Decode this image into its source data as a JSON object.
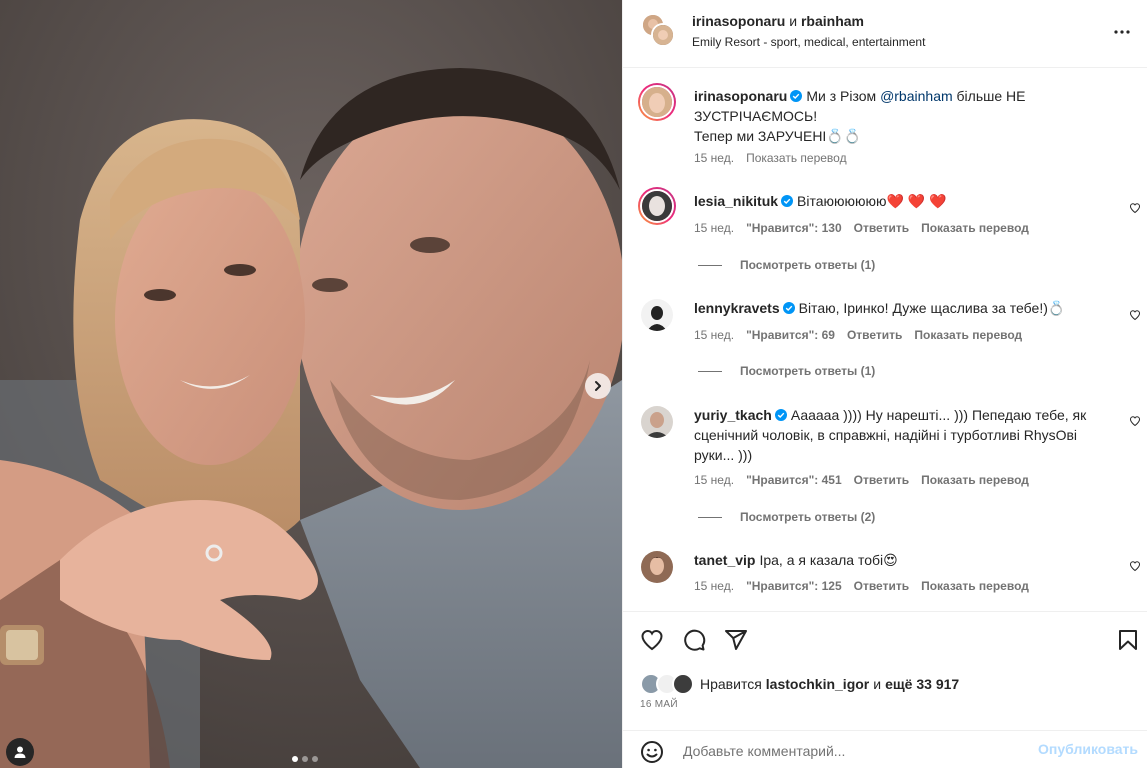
{
  "header": {
    "user1": "irinasoponaru",
    "and": "и",
    "user2": "rbainham",
    "location": "Emily Resort - sport, medical, entertainment"
  },
  "caption": {
    "username": "irinasoponaru",
    "line1_pre": "Ми з Різом ",
    "mention": "@rbainham",
    "line1_post": " більше НЕ ЗУСТРІЧАЄМОСЬ!",
    "line2": "Тепер ми ЗАРУЧЕНІ💍💍",
    "time": "15 нед.",
    "translate": "Показать перевод"
  },
  "comments": [
    {
      "username": "lesia_nikituk",
      "text": "Вітаюююююю❤️ ❤️ ❤️",
      "time": "15 нед.",
      "likes": "\"Нравится\": 130",
      "reply": "Ответить",
      "translate": "Показать перевод",
      "view_replies": "Посмотреть ответы (1)"
    },
    {
      "username": "lennykravets",
      "text": "Вітаю, Іринко! Дуже щаслива за тебе!)💍",
      "time": "15 нед.",
      "likes": "\"Нравится\": 69",
      "reply": "Ответить",
      "translate": "Показать перевод",
      "view_replies": "Посмотреть ответы (1)"
    },
    {
      "username": "yuriy_tkach",
      "text": "Аааааа )))) Ну нарешті... ))) Пепедаю тебе, як сценічний чоловік, в справжні, надійні і турботливі RhysOві руки... )))",
      "time": "15 нед.",
      "likes": "\"Нравится\": 451",
      "reply": "Ответить",
      "translate": "Показать перевод",
      "view_replies": "Посмотреть ответы (2)"
    },
    {
      "username": "tanet_vip",
      "text": "Іра, а я казала тобі😍",
      "time": "15 нед.",
      "likes": "\"Нравится\": 125",
      "reply": "Ответить",
      "translate": "Показать перевод"
    }
  ],
  "likes_bar": {
    "prefix": "Нравится",
    "user": "lastochkin_igor",
    "conj": "и",
    "more": "ещё 33 917"
  },
  "date": "16 МАЙ",
  "comment_box": {
    "placeholder": "Добавьте комментарий...",
    "publish": "Опубликовать"
  },
  "colors": {
    "verified": "#0095f6",
    "mention": "#00376b",
    "muted": "#737373",
    "publish_disabled": "#b3dbff",
    "heart_red": "#e0245e"
  },
  "icons": [
    "more-options-icon",
    "verified-icon",
    "heart-icon",
    "comment-icon",
    "share-icon",
    "bookmark-icon",
    "emoji-icon",
    "chevron-right-icon",
    "user-tag-icon"
  ]
}
